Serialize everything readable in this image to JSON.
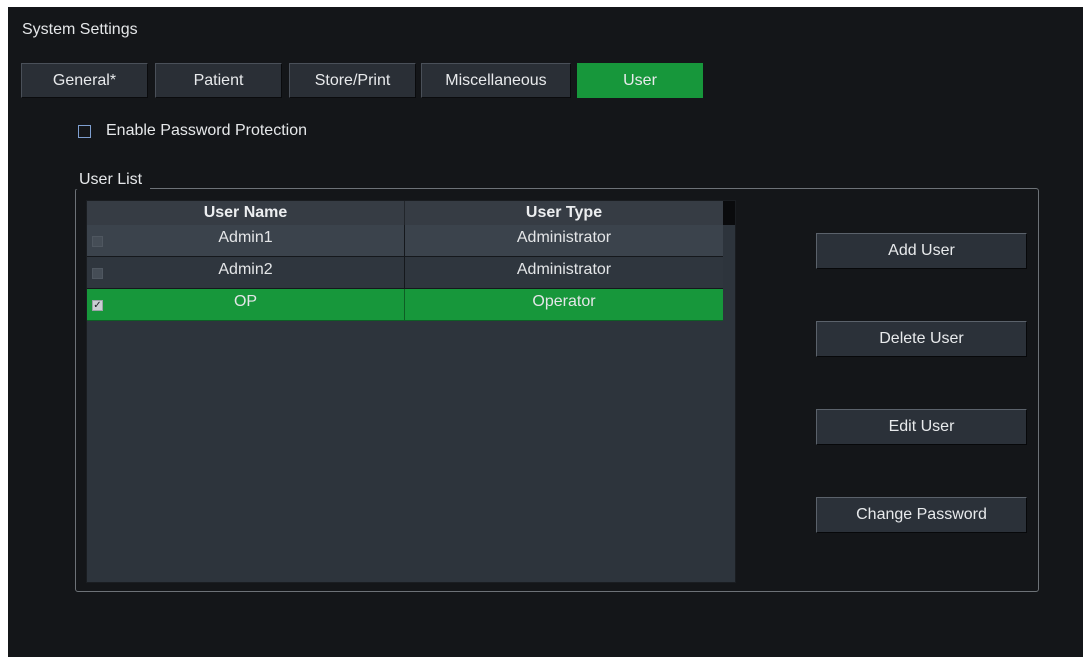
{
  "window": {
    "title": "System Settings"
  },
  "tabs": [
    {
      "label": "General*",
      "active": false
    },
    {
      "label": "Patient",
      "active": false
    },
    {
      "label": "Store/Print",
      "active": false
    },
    {
      "label": "Miscellaneous",
      "active": false
    },
    {
      "label": "User",
      "active": true
    }
  ],
  "password_protection": {
    "label": "Enable Password Protection",
    "checked": false
  },
  "user_list": {
    "legend": "User List",
    "columns": [
      "User Name",
      "User Type"
    ],
    "rows": [
      {
        "name": "Admin1",
        "type": "Administrator",
        "checked": false,
        "selected": false
      },
      {
        "name": "Admin2",
        "type": "Administrator",
        "checked": false,
        "selected": false
      },
      {
        "name": "OP",
        "type": "Operator",
        "checked": true,
        "selected": true
      }
    ]
  },
  "actions": {
    "add": "Add User",
    "delete": "Delete User",
    "edit": "Edit User",
    "change_password": "Change Password"
  },
  "colors": {
    "background": "#141619",
    "accent_green": "#17973b",
    "panel": "#2d343c",
    "button": "#2b3139"
  },
  "icons": {
    "row_check": "✓"
  }
}
